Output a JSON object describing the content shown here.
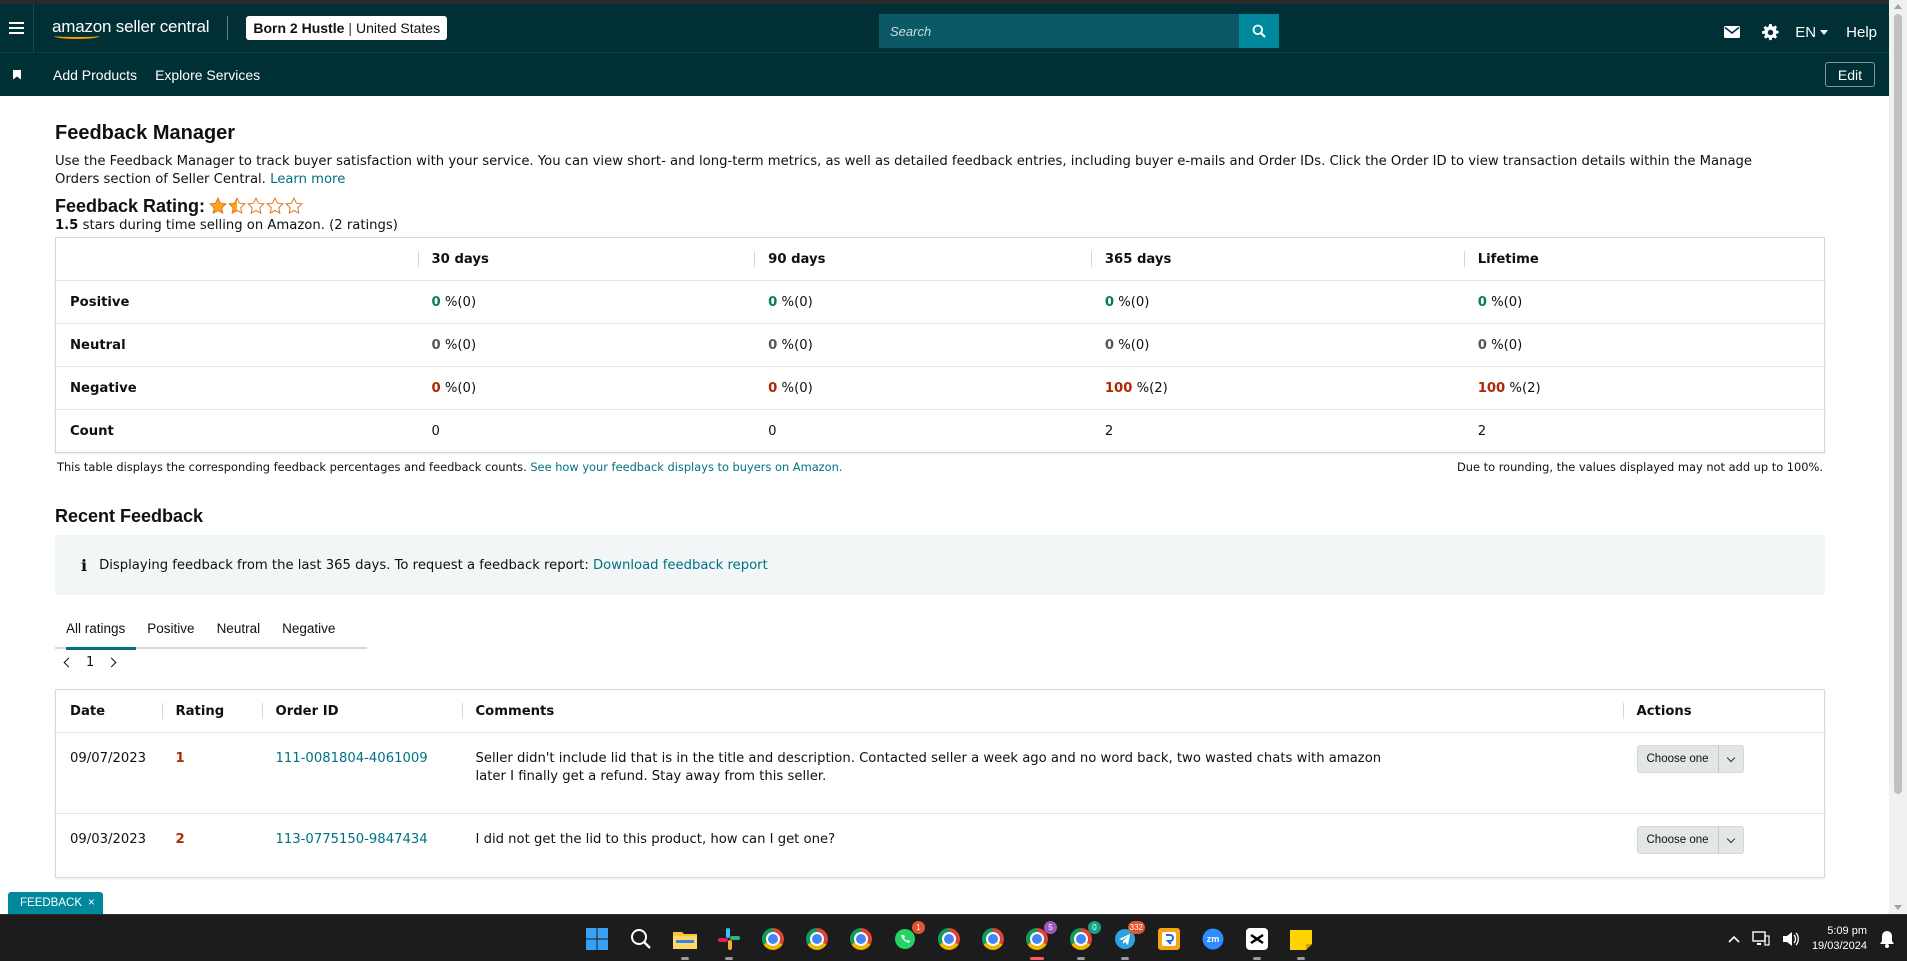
{
  "header": {
    "logo_text": "amazon seller central",
    "account_name": "Born 2 Hustle",
    "account_separator": "|",
    "marketplace": "United States",
    "search_placeholder": "Search",
    "language": "EN",
    "help": "Help"
  },
  "nav": {
    "items": [
      "Add Products",
      "Explore Services"
    ],
    "edit": "Edit"
  },
  "page": {
    "title": "Feedback Manager",
    "intro": "Use the Feedback Manager to track buyer satisfaction with your service. You can view short- and long-term metrics, as well as detailed feedback entries, including buyer e-mails and Order IDs. Click the Order ID to view transaction details within the Manage Orders section of Seller Central.",
    "learn_more": "Learn more"
  },
  "rating": {
    "label": "Feedback Rating:",
    "stars_value": 1.5,
    "stars_max": 5,
    "score": "1.5",
    "summary_text": " stars during time selling on Amazon. (",
    "count": "2",
    "ratings_word": " ratings)"
  },
  "metrics": {
    "columns": [
      "30 days",
      "90 days",
      "365 days",
      "Lifetime"
    ],
    "rows": [
      {
        "label": "Positive",
        "type": "pos",
        "cells": [
          {
            "v": "0",
            "p": " %(0)"
          },
          {
            "v": "0",
            "p": " %(0)"
          },
          {
            "v": "0",
            "p": " %(0)"
          },
          {
            "v": "0",
            "p": " %(0)"
          }
        ]
      },
      {
        "label": "Neutral",
        "type": "neu",
        "cells": [
          {
            "v": "0",
            "p": " %(0)"
          },
          {
            "v": "0",
            "p": " %(0)"
          },
          {
            "v": "0",
            "p": " %(0)"
          },
          {
            "v": "0",
            "p": " %(0)"
          }
        ]
      },
      {
        "label": "Negative",
        "type": "neg",
        "cells": [
          {
            "v": "0",
            "p": " %(0)"
          },
          {
            "v": "0",
            "p": " %(0)"
          },
          {
            "v": "100",
            "p": " %(2)"
          },
          {
            "v": "100",
            "p": " %(2)"
          }
        ]
      }
    ],
    "count_label": "Count",
    "counts": [
      "0",
      "0",
      "2",
      "2"
    ],
    "note_left": "This table displays the corresponding feedback percentages and feedback counts.",
    "note_link": "See how your feedback displays to buyers on Amazon.",
    "note_right": "Due to rounding, the values displayed may not add up to 100%."
  },
  "recent": {
    "title": "Recent Feedback",
    "info_icon": "i",
    "info_text": "Displaying feedback from the last 365 days. To request a feedback report:",
    "info_link": "Download feedback report",
    "tabs": [
      "All ratings",
      "Positive",
      "Neutral",
      "Negative"
    ],
    "page": "1",
    "columns": [
      "Date",
      "Rating",
      "Order ID",
      "Comments",
      "Actions"
    ],
    "rows": [
      {
        "date": "09/07/2023",
        "rating": "1",
        "order_id": "111-0081804-4061009",
        "comment": "Seller didn't include lid that is in the title and description. Contacted seller a week ago and no word back, two wasted chats with amazon later I finally get a refund. Stay away from this seller.",
        "action": "Choose one"
      },
      {
        "date": "09/03/2023",
        "rating": "2",
        "order_id": "113-0775150-9847434",
        "comment": "I did not get the lid to this product, how can I get one?",
        "action": "Choose one"
      }
    ]
  },
  "feedback_tab": {
    "label": "FEEDBACK",
    "close": "×"
  },
  "taskbar": {
    "icons": [
      "windows-start-icon",
      "search-icon",
      "file-explorer-icon",
      "slack-icon",
      "chrome-icon",
      "chrome-icon",
      "chrome-icon",
      "whatsapp-icon",
      "chrome-icon",
      "chrome-icon",
      "chrome-icon",
      "chrome-icon",
      "telegram-icon",
      "rd-app-icon",
      "zoom-icon",
      "capcut-icon",
      "sticky-notes-icon"
    ],
    "badges": {
      "whatsapp": "1",
      "chrome_active": "5",
      "chrome_green": "0",
      "telegram": "332"
    },
    "time": "5:09 pm",
    "date": "19/03/2024"
  },
  "colors": {
    "header_bg": "#002f36",
    "accent": "#00899d",
    "link": "#007185",
    "positive": "#067d62",
    "negative": "#b12704",
    "star": "#ffa41c"
  }
}
